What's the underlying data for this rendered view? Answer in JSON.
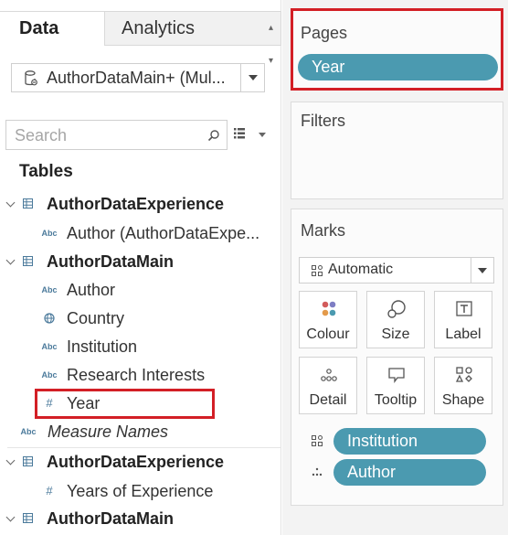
{
  "tabs": {
    "data": "Data",
    "analytics": "Analytics"
  },
  "datasource": {
    "name": "AuthorDataMain+ (Mul..."
  },
  "search": {
    "placeholder": "Search"
  },
  "tables_heading": "Tables",
  "tree": [
    {
      "kind": "table",
      "label": "AuthorDataExperience"
    },
    {
      "kind": "field",
      "icon": "Abc",
      "label": "Author (AuthorDataExpe..."
    },
    {
      "kind": "table",
      "label": "AuthorDataMain"
    },
    {
      "kind": "field",
      "icon": "Abc",
      "label": "Author"
    },
    {
      "kind": "field",
      "icon": "globe",
      "label": "Country"
    },
    {
      "kind": "field",
      "icon": "Abc",
      "label": "Institution"
    },
    {
      "kind": "field",
      "icon": "Abc",
      "label": "Research Interests"
    },
    {
      "kind": "field",
      "icon": "#",
      "label": "Year"
    },
    {
      "kind": "field",
      "icon": "Abc",
      "label": "Measure Names"
    },
    {
      "kind": "table",
      "label": "AuthorDataExperience"
    },
    {
      "kind": "field",
      "icon": "#",
      "label": "Years of Experience"
    },
    {
      "kind": "table",
      "label": "AuthorDataMain"
    }
  ],
  "pages": {
    "title": "Pages",
    "pill": "Year"
  },
  "filters": {
    "title": "Filters"
  },
  "marks": {
    "title": "Marks",
    "type": "Automatic",
    "buttons": [
      "Colour",
      "Size",
      "Label",
      "Detail",
      "Tooltip",
      "Shape"
    ],
    "shelf": [
      {
        "icon": "shape-icon",
        "label": "Institution"
      },
      {
        "icon": "detail-icon",
        "label": "Author"
      }
    ]
  },
  "colors": {
    "pill": "#4b9ab0",
    "highlight": "#d31f26",
    "field_icon": "#4b7a9b"
  }
}
